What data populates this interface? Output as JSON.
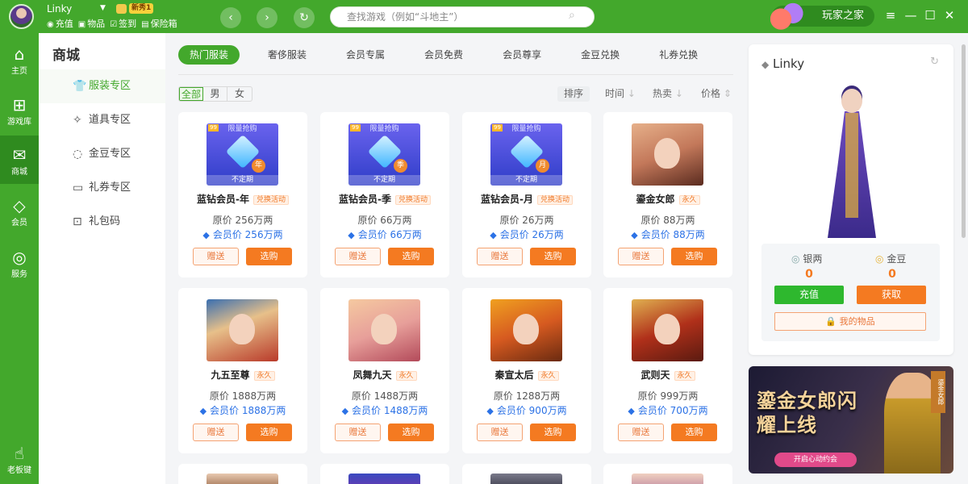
{
  "header": {
    "username": "Linky",
    "newbie_badge": "新秀1",
    "quick_links": [
      {
        "icon": "wallet-icon",
        "label": "充值"
      },
      {
        "icon": "bag-icon",
        "label": "物品"
      },
      {
        "icon": "calendar-check-icon",
        "label": "签到"
      },
      {
        "icon": "safe-box-icon",
        "label": "保险箱"
      }
    ],
    "search_placeholder": "查找游戏（例如“斗地主”）",
    "player_home": "玩家之家"
  },
  "sidebar": {
    "items": [
      {
        "icon": "home-icon",
        "label": "主页",
        "active": false
      },
      {
        "icon": "gamepad-icon",
        "label": "游戏库",
        "active": false
      },
      {
        "icon": "mall-icon",
        "label": "商城",
        "active": true
      },
      {
        "icon": "member-diamond-icon",
        "label": "会员",
        "active": false
      },
      {
        "icon": "service-icon",
        "label": "服务",
        "active": false
      }
    ],
    "boss_key": "老板键"
  },
  "categories": {
    "title": "商城",
    "items": [
      {
        "icon": "shirt-icon",
        "label": "服装专区",
        "active": true
      },
      {
        "icon": "prop-icon",
        "label": "道具专区",
        "active": false
      },
      {
        "icon": "coin-icon",
        "label": "金豆专区",
        "active": false
      },
      {
        "icon": "ticket-icon",
        "label": "礼券专区",
        "active": false
      },
      {
        "icon": "gift-box-icon",
        "label": "礼包码",
        "active": false
      }
    ]
  },
  "tabs": [
    "热门服装",
    "奢侈服装",
    "会员专属",
    "会员免费",
    "会员尊享",
    "金豆兑换",
    "礼券兑换"
  ],
  "filters": {
    "gender": [
      "全部",
      "男",
      "女"
    ],
    "sort_label": "排序",
    "sort_time": "时间",
    "sort_hot": "热卖",
    "sort_price": "价格"
  },
  "products": [
    {
      "name": "蓝钻会员-年",
      "tag": "兑换活动",
      "original": "原价 256万两",
      "member": "会员价 256万两",
      "type": "vip",
      "unit": "年"
    },
    {
      "name": "蓝钻会员-季",
      "tag": "兑换活动",
      "original": "原价 66万两",
      "member": "会员价 66万两",
      "type": "vip",
      "unit": "季"
    },
    {
      "name": "蓝钻会员-月",
      "tag": "兑换活动",
      "original": "原价 26万两",
      "member": "会员价 26万两",
      "type": "vip",
      "unit": "月"
    },
    {
      "name": "鎏金女郎",
      "tag": "永久",
      "original": "原价 88万两",
      "member": "会员价 88万两",
      "type": "portrait"
    },
    {
      "name": "九五至尊",
      "tag": "永久",
      "original": "原价 1888万两",
      "member": "会员价 1888万两",
      "type": "portrait"
    },
    {
      "name": "凤舞九天",
      "tag": "永久",
      "original": "原价 1488万两",
      "member": "会员价 1488万两",
      "type": "portrait"
    },
    {
      "name": "秦宣太后",
      "tag": "永久",
      "original": "原价 1288万两",
      "member": "会员价 900万两",
      "type": "portrait"
    },
    {
      "name": "武则天",
      "tag": "永久",
      "original": "原价 999万两",
      "member": "会员价 700万两",
      "type": "portrait"
    }
  ],
  "vip_card": {
    "flash": "限量抢购",
    "period": "不定期",
    "badge": "99"
  },
  "card_buttons": {
    "gift": "赠送",
    "buy": "选购"
  },
  "profile": {
    "name": "Linky",
    "silver_label": "银两",
    "silver_value": "0",
    "gold_label": "金豆",
    "gold_value": "0",
    "charge": "充值",
    "get": "获取",
    "my_items": "我的物品"
  },
  "banner": {
    "title": "鎏金女郎闪耀上线",
    "button": "开启心动约会",
    "side_tag": "鎏金女郎"
  },
  "colors": {
    "brand_green": "#43a82c",
    "accent_orange": "#f47a21",
    "member_blue": "#2c72e6"
  }
}
